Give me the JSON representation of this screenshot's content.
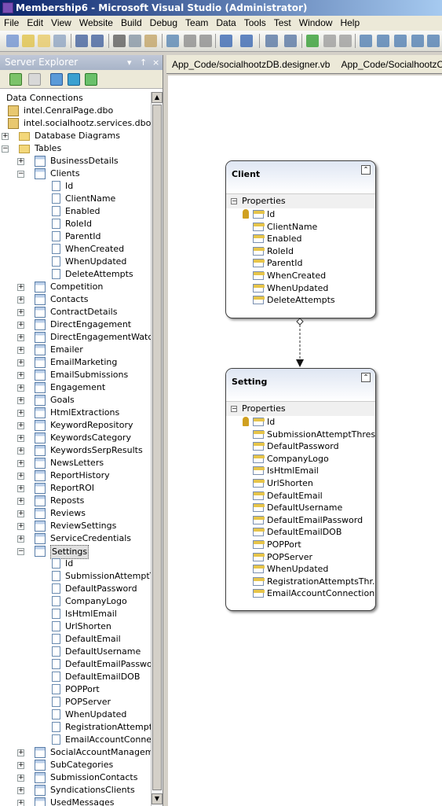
{
  "window": {
    "title": "Membership6 - Microsoft Visual Studio (Administrator)"
  },
  "menu": [
    "File",
    "Edit",
    "View",
    "Website",
    "Build",
    "Debug",
    "Team",
    "Data",
    "Tools",
    "Test",
    "Window",
    "Help"
  ],
  "server_explorer": {
    "title": "Server Explorer",
    "controls": {
      "pin": "▾",
      "autohide": "↑",
      "close": "×"
    },
    "tree": {
      "data_connections": "Data Connections",
      "connections": [
        "intel.CenralPage.dbo",
        "intel.socialhootz.services.dbo"
      ],
      "database_diagrams": "Database Diagrams",
      "tables_folder": "Tables",
      "tables_top": [
        "BusinessDetails"
      ],
      "clients_table": "Clients",
      "clients_columns": [
        "Id",
        "ClientName",
        "Enabled",
        "RoleId",
        "ParentId",
        "WhenCreated",
        "WhenUpdated",
        "DeleteAttempts"
      ],
      "tables_mid": [
        "Competition",
        "Contacts",
        "ContractDetails",
        "DirectEngagement",
        "DirectEngagementWatchw",
        "Emailer",
        "EmailMarketing",
        "EmailSubmissions",
        "Engagement",
        "Goals",
        "HtmlExtractions",
        "KeywordRepository",
        "KeywordsCategory",
        "KeywordsSerpResults",
        "NewsLetters",
        "ReportHistory",
        "ReportROI",
        "Reposts",
        "Reviews",
        "ReviewSettings",
        "ServiceCredentials"
      ],
      "settings_table": "Settings",
      "settings_columns": [
        "Id",
        "SubmissionAttemptThr",
        "DefaultPassword",
        "CompanyLogo",
        "IsHtmlEmail",
        "UrlShorten",
        "DefaultEmail",
        "DefaultUsername",
        "DefaultEmailPassword",
        "DefaultEmailDOB",
        "POPPort",
        "POPServer",
        "WhenUpdated",
        "RegistrationAttemptsT",
        "EmailAccountConnecti"
      ],
      "tables_bottom": [
        "SocialAccountManagemen",
        "SubCategories",
        "SubmissionContacts",
        "SyndicationsClients",
        "UsedMessages"
      ]
    }
  },
  "tabs": [
    "App_Code/socialhootzDB.designer.vb",
    "App_Code/SocialhootzCL.vb"
  ],
  "diagram": {
    "client": {
      "name": "Client",
      "section": "Properties",
      "properties": [
        "Id",
        "ClientName",
        "Enabled",
        "RoleId",
        "ParentId",
        "WhenCreated",
        "WhenUpdated",
        "DeleteAttempts"
      ]
    },
    "setting": {
      "name": "Setting",
      "section": "Properties",
      "properties": [
        "Id",
        "SubmissionAttemptThres...",
        "DefaultPassword",
        "CompanyLogo",
        "IsHtmlEmail",
        "UrlShorten",
        "DefaultEmail",
        "DefaultUsername",
        "DefaultEmailPassword",
        "DefaultEmailDOB",
        "POPPort",
        "POPServer",
        "WhenUpdated",
        "RegistrationAttemptsThr...",
        "EmailAccountConnection..."
      ]
    }
  }
}
